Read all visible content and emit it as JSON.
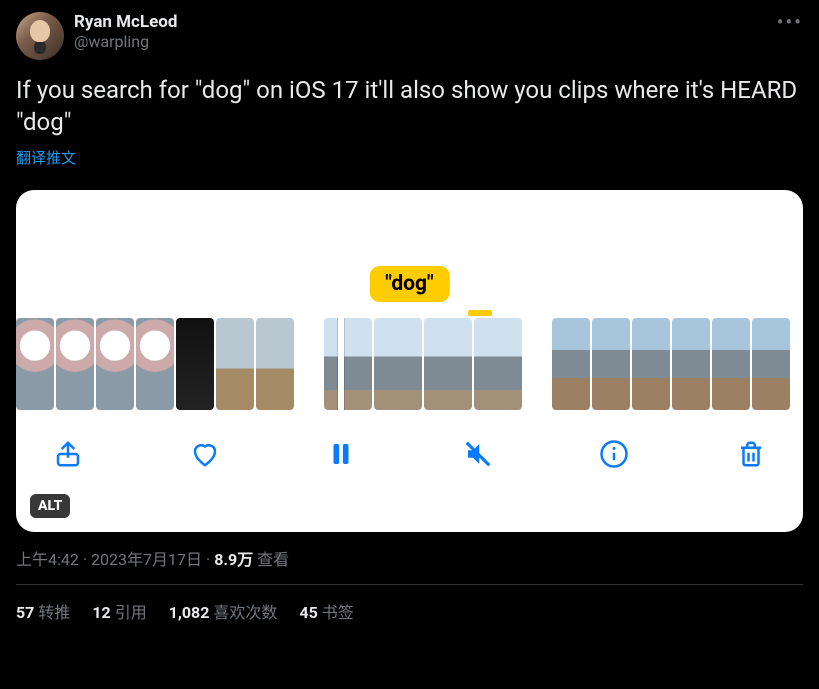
{
  "author": {
    "display_name": "Ryan McLeod",
    "handle": "@warpling"
  },
  "tweet": {
    "text": "If you search for \"dog\" on iOS 17 it'll also show you clips where it's HEARD \"dog\"",
    "translate_label": "翻译推文"
  },
  "media": {
    "search_tag": "\"dog\"",
    "alt_badge": "ALT",
    "toolbar_icons": {
      "share": "share-icon",
      "like": "heart-icon",
      "pause": "pause-icon",
      "mute": "mute-icon",
      "info": "info-icon",
      "trash": "trash-icon"
    }
  },
  "meta": {
    "time": "上午4:42",
    "date": "2023年7月17日",
    "views_value": "8.9万",
    "views_label": "查看"
  },
  "stats": {
    "retweets": {
      "count": "57",
      "label": "转推"
    },
    "quotes": {
      "count": "12",
      "label": "引用"
    },
    "likes": {
      "count": "1,082",
      "label": "喜欢次数"
    },
    "bookmarks": {
      "count": "45",
      "label": "书签"
    }
  },
  "more_label": "•••"
}
